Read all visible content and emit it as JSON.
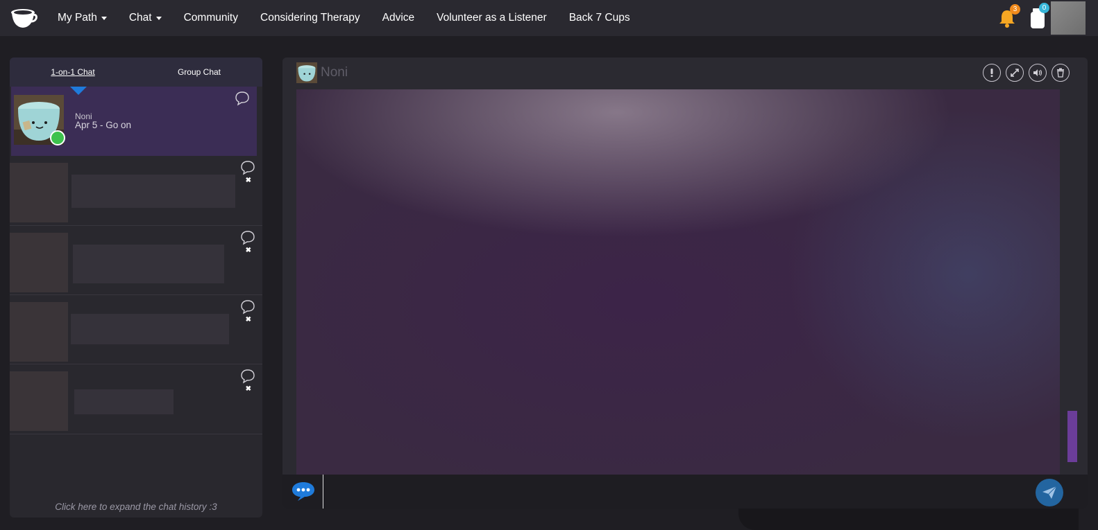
{
  "nav": {
    "items": [
      {
        "label": "My Path",
        "caret": true
      },
      {
        "label": "Chat",
        "caret": true
      },
      {
        "label": "Community",
        "caret": false
      },
      {
        "label": "Considering Therapy",
        "caret": false
      },
      {
        "label": "Advice",
        "caret": false
      },
      {
        "label": "Volunteer as a Listener",
        "caret": false
      },
      {
        "label": "Back 7 Cups",
        "caret": false
      }
    ],
    "notifications_count": "3",
    "jar_count": "0",
    "badge_colors": {
      "notifications": "#f08a1c",
      "jar": "#37b5d8"
    }
  },
  "sidebar": {
    "tabs": {
      "one_on_one": "1-on-1 Chat",
      "group": "Group Chat"
    },
    "active_chat": {
      "name": "Noni",
      "preview": "Apr 5 - Go on",
      "online": true
    },
    "other_chats_count_visible": 4,
    "expand_text": "Click here to expand the chat history :3",
    "remove_symbol": "✖"
  },
  "chat": {
    "partner_name": "Noni",
    "input_value": "",
    "colors": {
      "accent": "#1f7bdb",
      "active_row": "#3b2d55",
      "scrollbar": "#6b3d99",
      "send": "#2365a0",
      "online": "#3dc24d"
    }
  }
}
